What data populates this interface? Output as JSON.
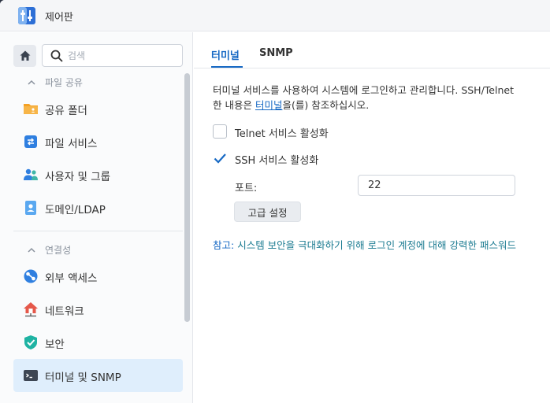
{
  "window": {
    "title": "제어판"
  },
  "sidebar": {
    "search_placeholder": "검색",
    "groups": [
      {
        "label": "파일 공유",
        "items": [
          {
            "label": "공유 폴더",
            "icon": "shared-folder-icon"
          },
          {
            "label": "파일 서비스",
            "icon": "file-services-icon"
          },
          {
            "label": "사용자 및 그룹",
            "icon": "users-groups-icon"
          },
          {
            "label": "도메인/LDAP",
            "icon": "domain-ldap-icon"
          }
        ]
      },
      {
        "label": "연결성",
        "items": [
          {
            "label": "외부 액세스",
            "icon": "external-access-icon"
          },
          {
            "label": "네트워크",
            "icon": "network-icon"
          },
          {
            "label": "보안",
            "icon": "security-shield-icon"
          },
          {
            "label": "터미널 및 SNMP",
            "icon": "terminal-icon",
            "active": true
          }
        ]
      }
    ]
  },
  "tabs": [
    {
      "label": "터미널",
      "active": true
    },
    {
      "label": "SNMP",
      "active": false
    }
  ],
  "content": {
    "desc_line1": "터미널 서비스를 사용하여 시스템에 로그인하고 관리합니다. SSH/Telnet",
    "desc_line2_pre": "한 내용은 ",
    "desc_link": "터미널",
    "desc_line2_post": "을(를) 참조하십시오.",
    "telnet_label": "Telnet 서비스 활성화",
    "telnet_checked": false,
    "ssh_label": "SSH 서비스 활성화",
    "ssh_checked": true,
    "port_label": "포트:",
    "port_value": "22",
    "advanced_button": "고급 설정",
    "note_key": "참고:",
    "note_text": " 시스템 보안을 극대화하기 위해 로그인 계정에 대해 강력한 패스워드"
  },
  "colors": {
    "accent": "#1769c4",
    "active_bg": "#dfeefc",
    "note_text": "#1b7b91"
  }
}
